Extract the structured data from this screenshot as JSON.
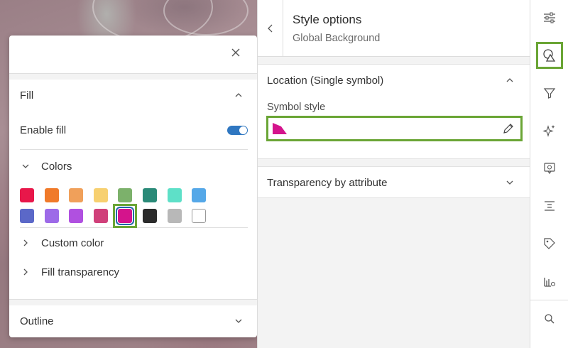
{
  "fill_panel": {
    "fill_label": "Fill",
    "enable_fill_label": "Enable fill",
    "enable_fill_on": true,
    "colors_label": "Colors",
    "swatches": [
      "#e8174a",
      "#f07a2a",
      "#f0a05a",
      "#f7d070",
      "#7cb16b",
      "#2a8a78",
      "#5ee0c8",
      "#55a8e8",
      "#5b68c8",
      "#9d6ae8",
      "#b050e0",
      "#d0407a",
      "#d4148c",
      "#2b2b2b",
      "#b8b8b8",
      "#ffffff"
    ],
    "selected_swatch": 12,
    "custom_color_label": "Custom color",
    "fill_transparency_label": "Fill transparency",
    "outline_label": "Outline"
  },
  "style_options": {
    "title": "Style options",
    "subtitle": "Global Background",
    "location_label": "Location (Single symbol)",
    "symbol_style_label": "Symbol style",
    "symbol_color": "#d4148c",
    "transparency_label": "Transparency by attribute"
  },
  "toolbar": {
    "items": [
      "properties-icon",
      "styles-icon",
      "filter-icon",
      "effects-icon",
      "configure-popups-icon",
      "configure-fields-icon",
      "labels-icon",
      "configure-charts-icon",
      "search-icon"
    ],
    "active": "styles-icon"
  },
  "colors": {
    "accent_highlight": "#6aa535",
    "toggle_blue": "#2f77c1"
  }
}
